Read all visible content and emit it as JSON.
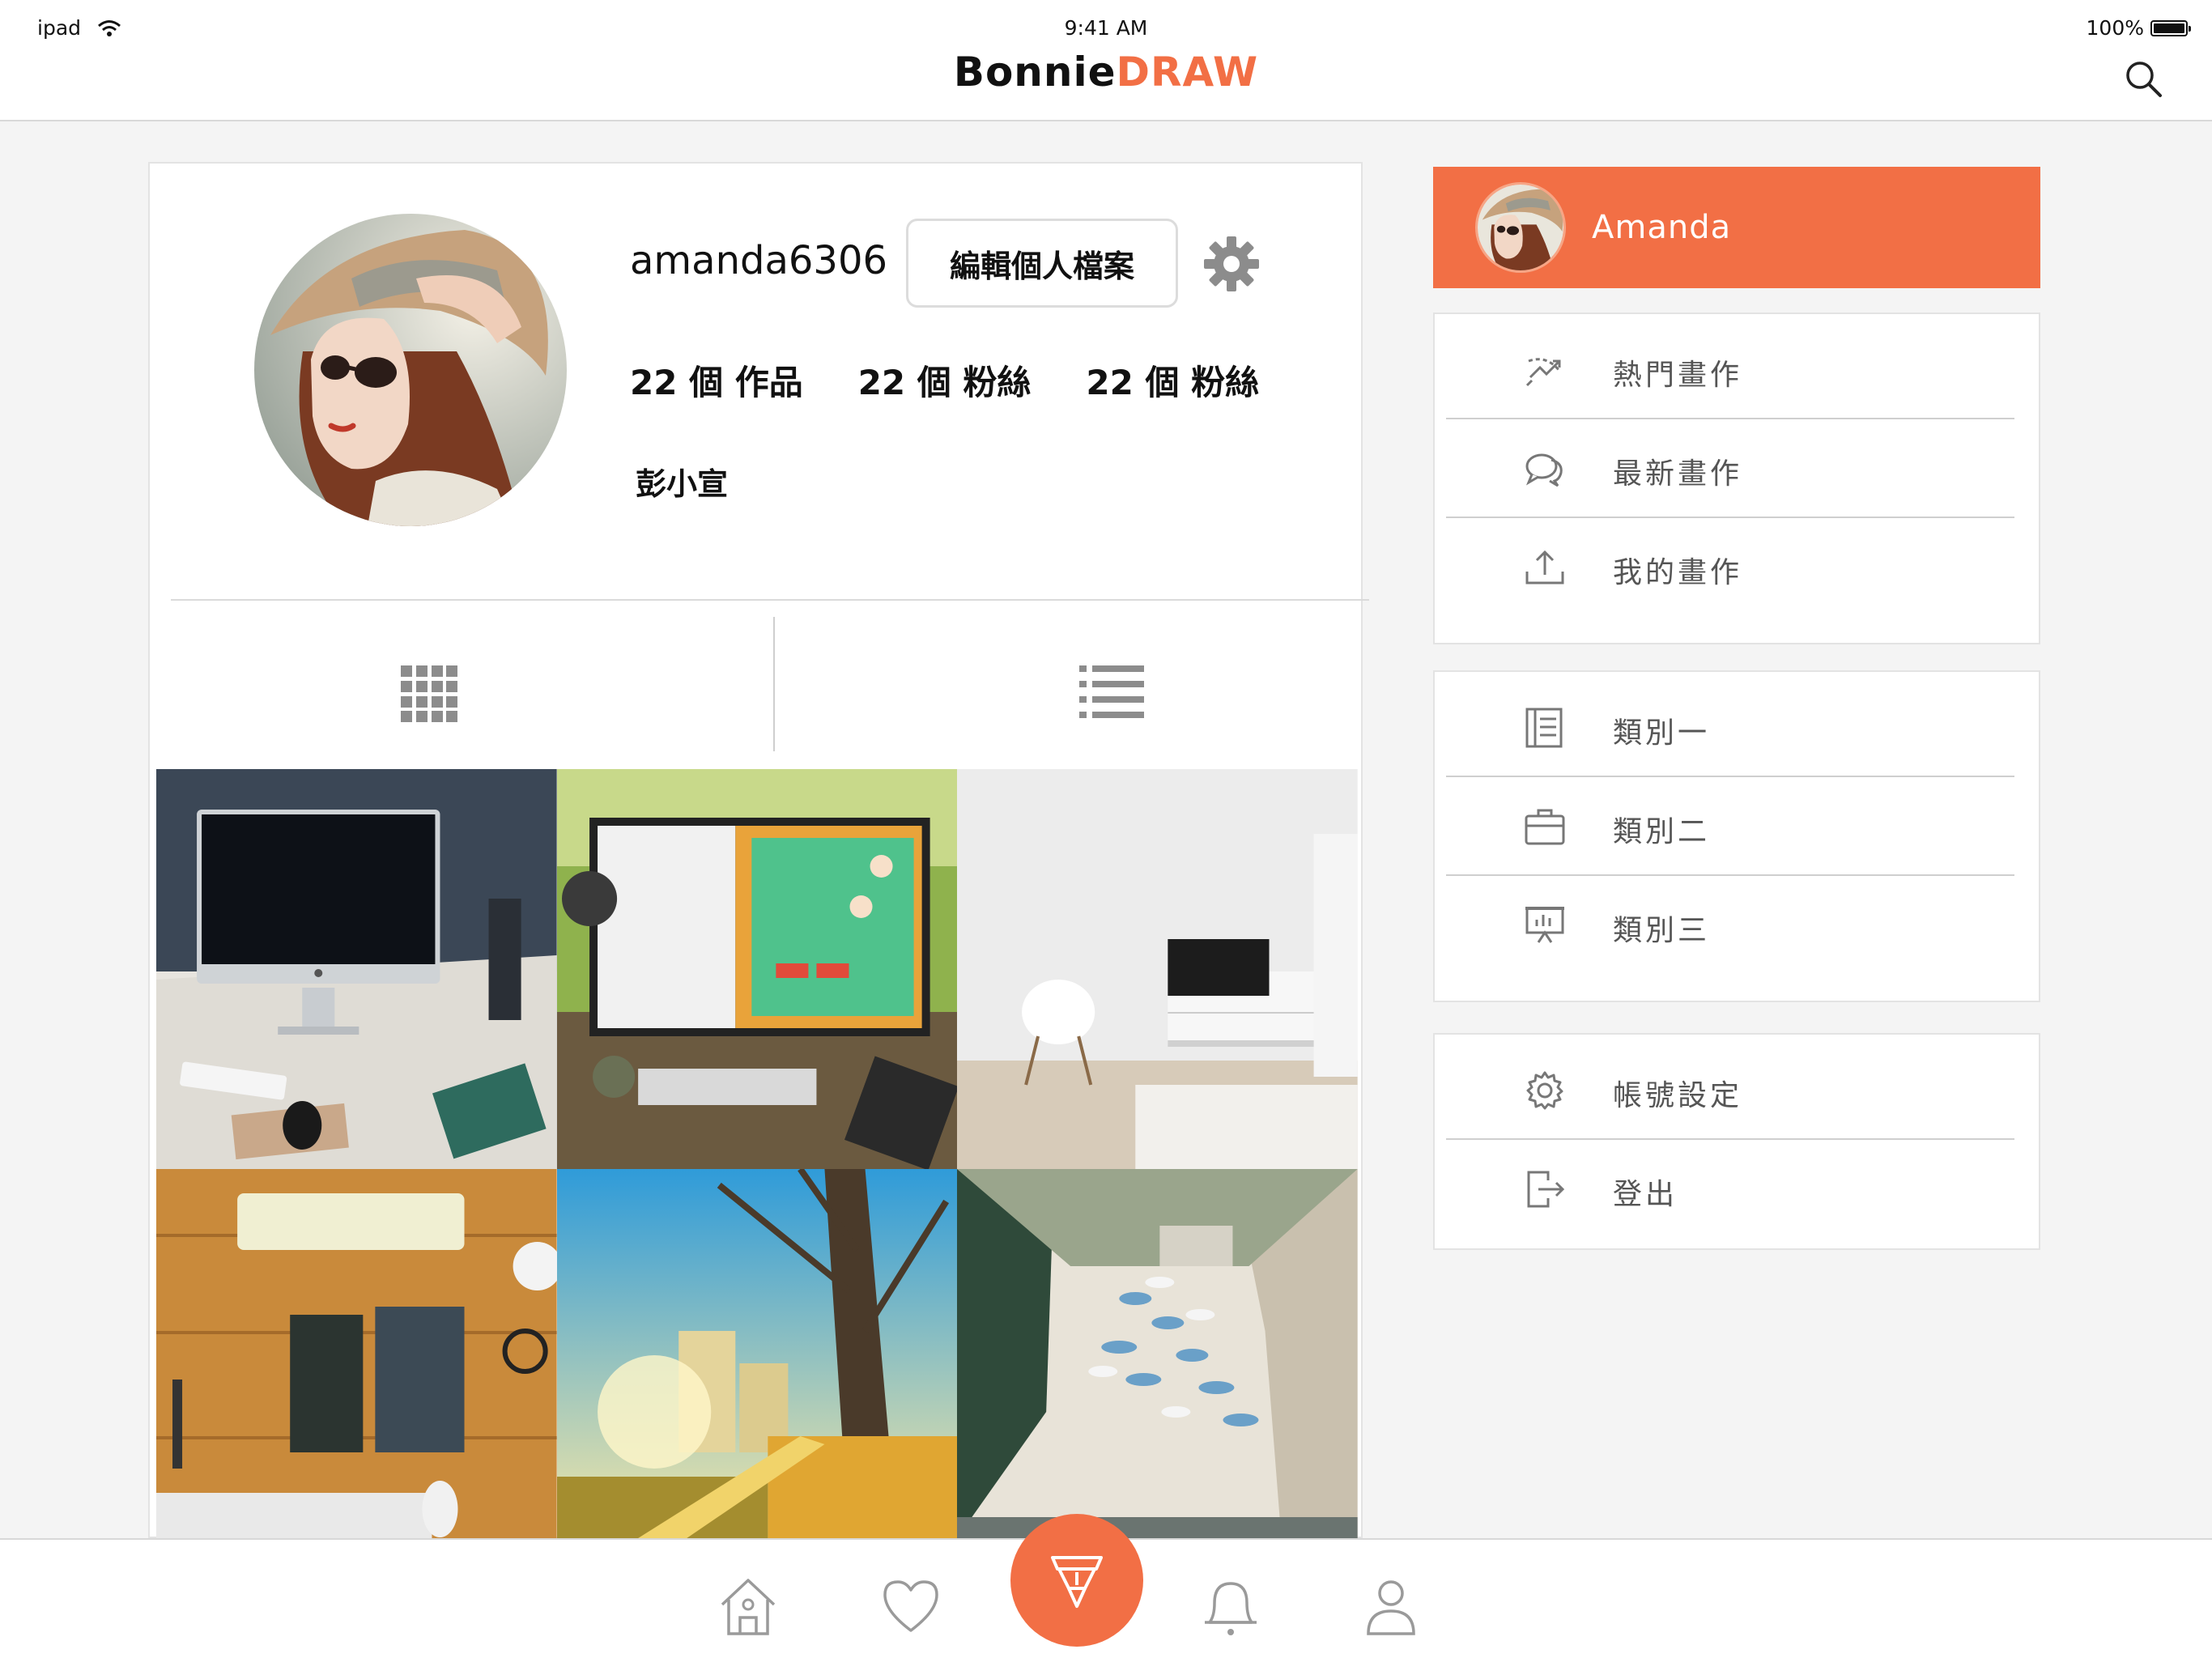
{
  "status_bar": {
    "device": "ipad",
    "time": "9:41 AM",
    "battery": "100%",
    "battery_level": 1.0
  },
  "header": {
    "brand_part1": "Bonnie",
    "brand_part2": "DRAW",
    "brand_accent_color": "#f26f45",
    "search_icon": "search-icon"
  },
  "profile": {
    "username": "amanda6306",
    "edit_button": "編輯個人檔案",
    "settings_icon": "gear-icon",
    "stats": [
      "22 個 作品",
      "22 個 粉絲",
      "22 個 粉絲"
    ],
    "real_name": "彭小宣"
  },
  "view_toggle": {
    "grid_icon": "grid-view-icon",
    "list_icon": "list-view-icon"
  },
  "photos": [
    "imac-desk",
    "desk-monitor-plants",
    "white-room-chair",
    "wooden-desk-flatlay",
    "autumn-trees-city",
    "boats-beach-cliffs"
  ],
  "sidebar": {
    "user_name": "Amanda",
    "groups": [
      [
        {
          "label": "熱門畫作",
          "icon": "trending-icon"
        },
        {
          "label": "最新畫作",
          "icon": "chat-bubbles-icon"
        },
        {
          "label": "我的畫作",
          "icon": "upload-icon"
        }
      ],
      [
        {
          "label": "類別一",
          "icon": "notebook-icon"
        },
        {
          "label": "類別二",
          "icon": "briefcase-icon"
        },
        {
          "label": "類別三",
          "icon": "presentation-icon"
        }
      ],
      [
        {
          "label": "帳號設定",
          "icon": "gear-icon"
        },
        {
          "label": "登出",
          "icon": "logout-icon"
        }
      ]
    ]
  },
  "tabbar": {
    "tabs": [
      "home-icon",
      "heart-icon",
      "brush-icon",
      "bell-icon",
      "person-icon"
    ],
    "active_color": "#f26f45"
  }
}
